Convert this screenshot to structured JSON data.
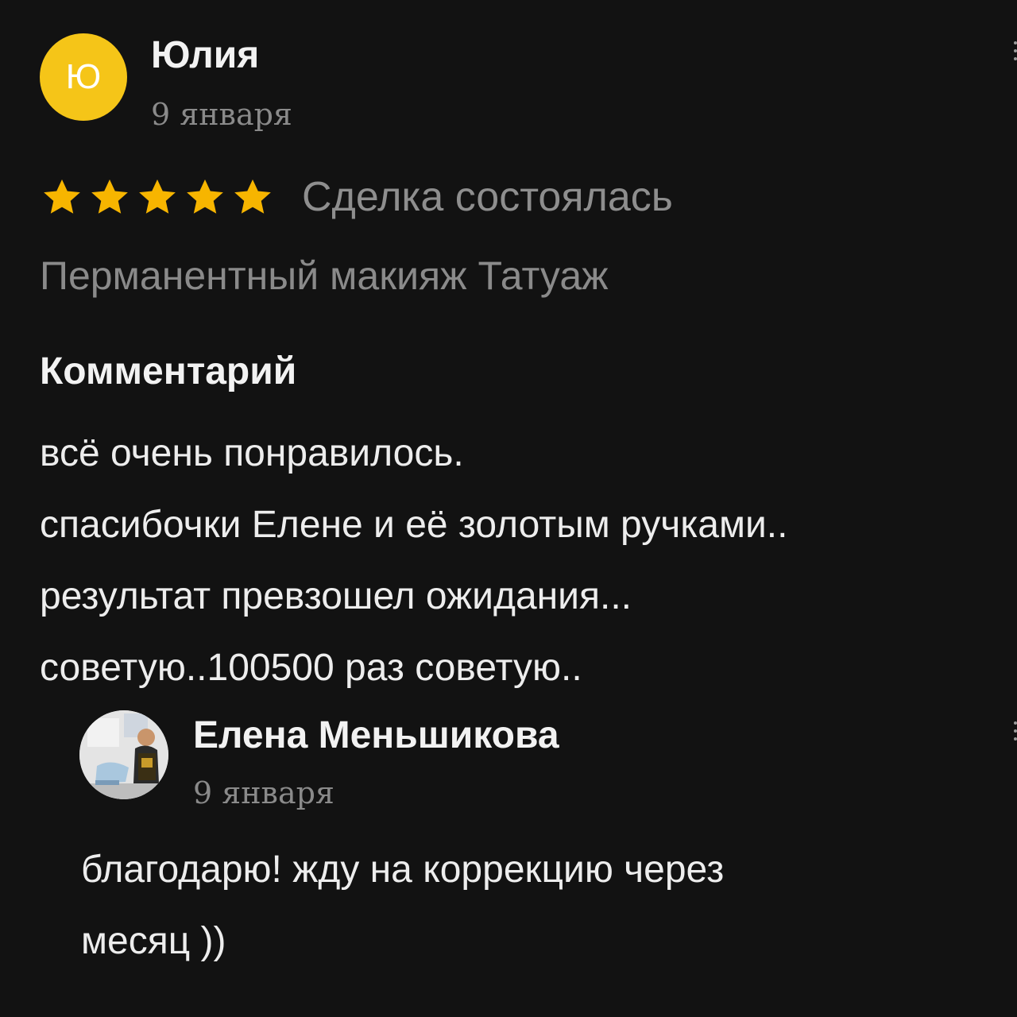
{
  "review": {
    "author": {
      "name": "Юлия",
      "initial": "Ю",
      "avatar_color": "#f5c518",
      "date": "9 января"
    },
    "rating": {
      "stars": 5,
      "max_stars": 5,
      "star_color": "#f7b500"
    },
    "deal_status": "Сделка состоялась",
    "service": "Перманентный макияж Татуаж",
    "comment_heading": "Комментарий",
    "comment_lines": [
      "всё очень понравилось.",
      "спасибочки Елене и её золотым ручками..",
      "результат превзошел ожидания...",
      "советую..100500 раз советую.."
    ]
  },
  "reply": {
    "author": {
      "name": "Елена Меньшикова",
      "date": "9 января"
    },
    "text_lines": [
      "благодарю! жду на коррекцию через",
      "месяц ))"
    ]
  },
  "icons": {
    "star": "star-icon",
    "more": "more-vertical-icon",
    "avatar_photo": "profile-photo-icon"
  }
}
